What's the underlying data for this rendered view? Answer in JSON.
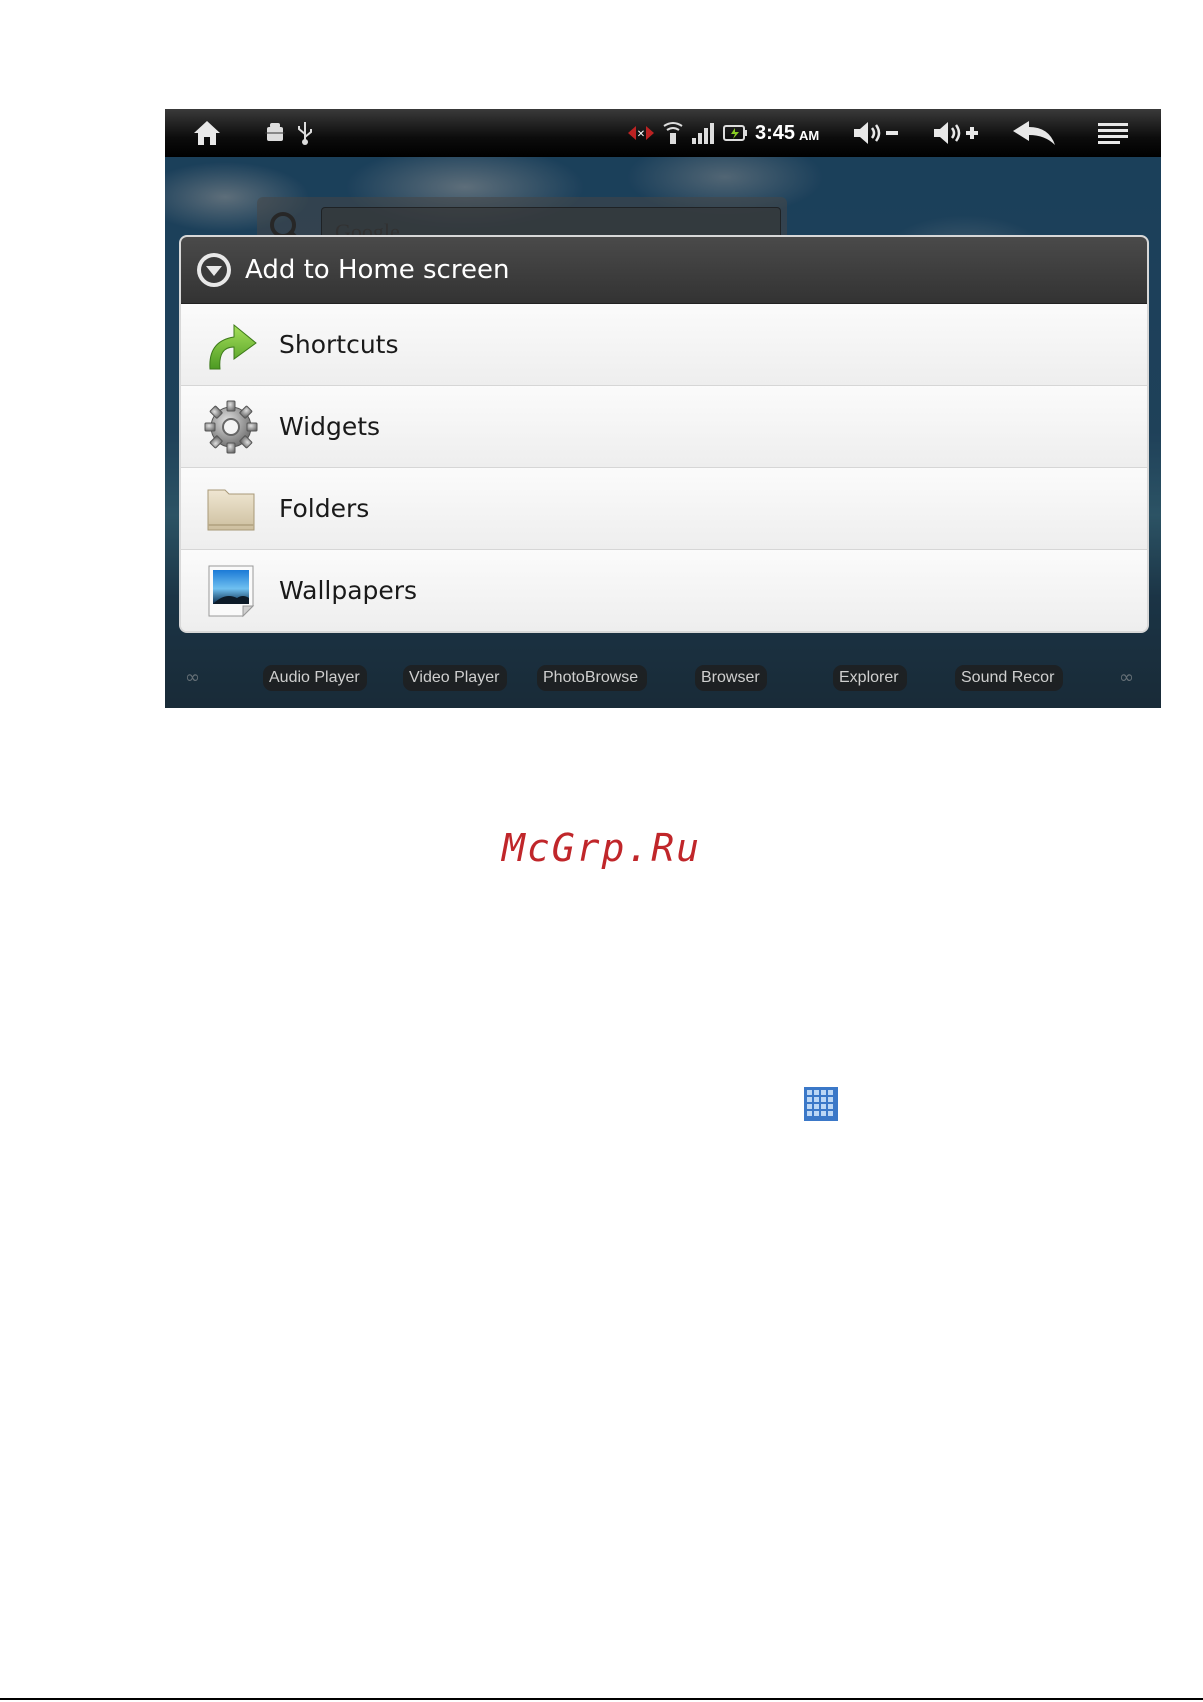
{
  "statusbar": {
    "time": "3:45",
    "ampm": "AM",
    "icons": [
      "home-icon",
      "android-debug-icon",
      "usb-icon",
      "no-signal-icon",
      "wifi-icon",
      "signal-bars-icon",
      "battery-charging-icon",
      "volume-down-icon",
      "volume-up-icon",
      "back-icon",
      "menu-icon"
    ]
  },
  "search_widget": {
    "placeholder": "Google"
  },
  "dialog": {
    "title": "Add to Home screen",
    "items": [
      {
        "label": "Shortcuts",
        "icon": "shortcut-arrow-icon"
      },
      {
        "label": "Widgets",
        "icon": "gear-icon"
      },
      {
        "label": "Folders",
        "icon": "folder-icon"
      },
      {
        "label": "Wallpapers",
        "icon": "picture-icon"
      }
    ]
  },
  "dock": {
    "apps": [
      "Audio Player",
      "Video Player",
      "PhotoBrowse",
      "Browser",
      "Explorer",
      "Sound Recor"
    ]
  },
  "watermark": "McGrp.Ru",
  "colors": {
    "watermark": "#c0262a",
    "dialog_header": "#3a3a3a",
    "shortcut_arrow": "#7cc242"
  }
}
